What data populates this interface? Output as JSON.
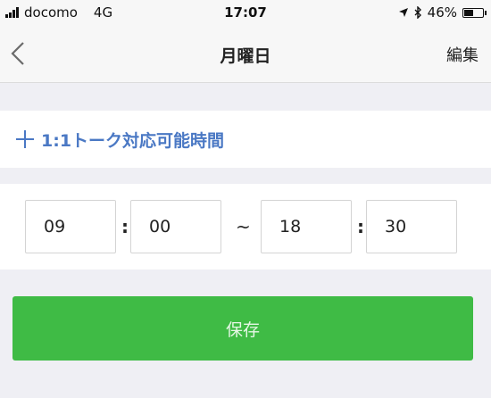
{
  "status_bar": {
    "carrier": "docomo",
    "network": "4G",
    "time": "17:07",
    "battery_percent": "46%",
    "battery_level": 0.46
  },
  "nav": {
    "title": "月曜日",
    "edit_label": "編集"
  },
  "add_hours": {
    "label": "1:1トーク対応可能時間"
  },
  "time_range": {
    "start_hour": "09",
    "start_minute": "00",
    "end_hour": "18",
    "end_minute": "30",
    "colon": ":",
    "tilde": "~"
  },
  "save": {
    "label": "保存"
  },
  "colors": {
    "accent_blue": "#4a78c4",
    "save_green": "#3fbb45",
    "background": "#efeff4"
  }
}
